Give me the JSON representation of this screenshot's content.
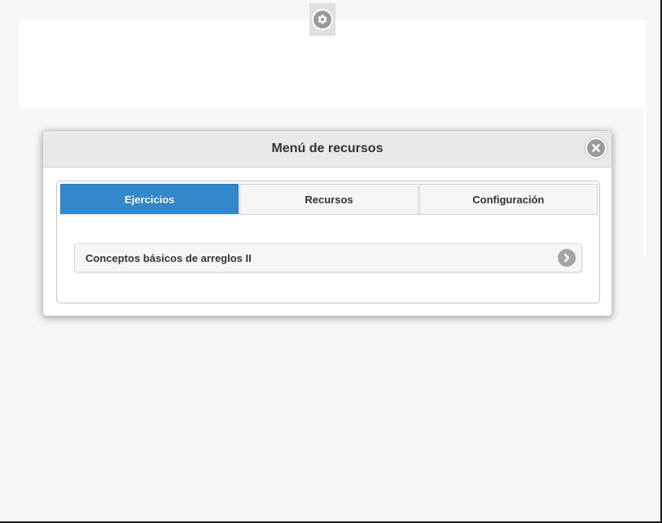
{
  "toolbar": {
    "settings_icon": "gear-icon"
  },
  "dialog": {
    "title": "Menú de recursos",
    "close_icon": "close-icon"
  },
  "tabs": [
    {
      "label": "Ejercicios",
      "active": true
    },
    {
      "label": "Recursos",
      "active": false
    },
    {
      "label": "Configuración",
      "active": false
    }
  ],
  "exercises": [
    {
      "label": "Conceptos básicos de arreglos II",
      "icon": "chevron-right-icon"
    }
  ],
  "colors": {
    "accent": "#3388cc",
    "background": "#f7f7f7",
    "header": "#e9e9e9"
  }
}
